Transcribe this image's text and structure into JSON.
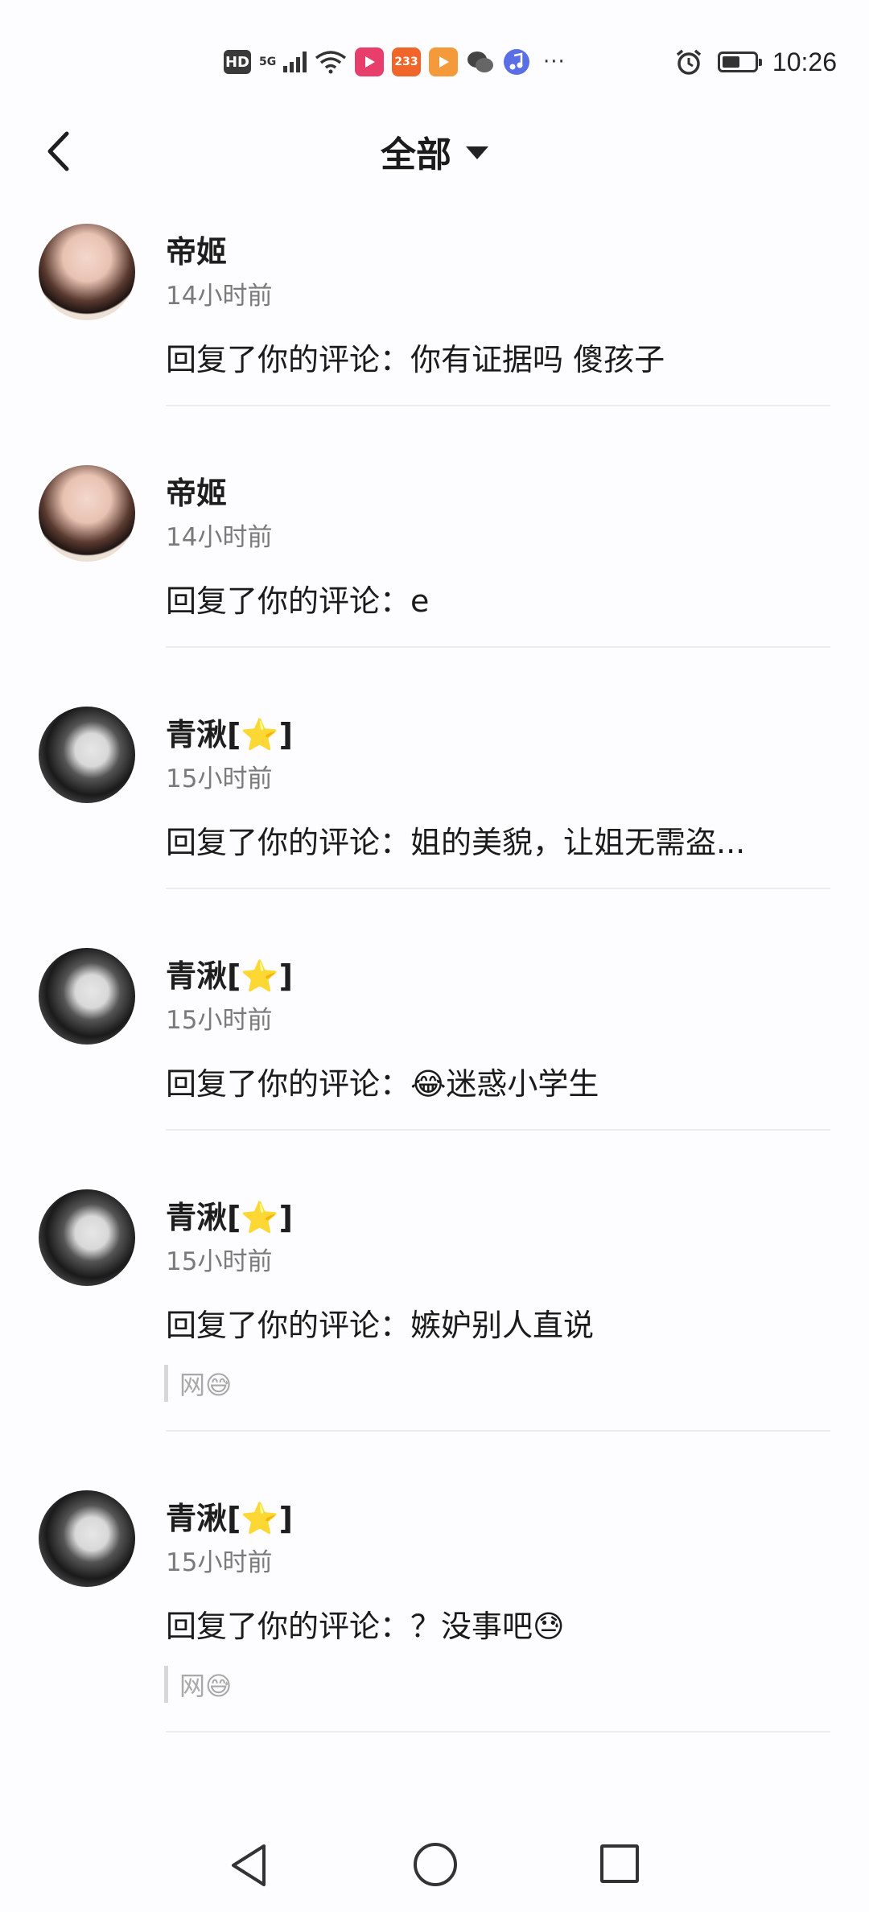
{
  "status_bar": {
    "hd_label": "HD",
    "network_label": "5G",
    "app_badge_233": "233",
    "more_dots": "···",
    "time": "10:26",
    "battery_level": 0.55
  },
  "header": {
    "title": "全部"
  },
  "items": [
    {
      "name": "帝姬",
      "time": "14小时前",
      "text": "回复了你的评论：你有证据吗 傻孩子",
      "quote": ""
    },
    {
      "name": "帝姬",
      "time": "14小时前",
      "text": "回复了你的评论：e",
      "quote": ""
    },
    {
      "name": "青湫[⭐]",
      "time": "15小时前",
      "text": "回复了你的评论：姐的美貌，让姐无需盗...",
      "quote": ""
    },
    {
      "name": "青湫[⭐]",
      "time": "15小时前",
      "text": "回复了你的评论：😂迷惑小学生",
      "quote": ""
    },
    {
      "name": "青湫[⭐]",
      "time": "15小时前",
      "text": "回复了你的评论：嫉妒别人直说",
      "quote": "网😅"
    },
    {
      "name": "青湫[⭐]",
      "time": "15小时前",
      "text": "回复了你的评论：？没事吧😓",
      "quote": "网😅"
    }
  ]
}
